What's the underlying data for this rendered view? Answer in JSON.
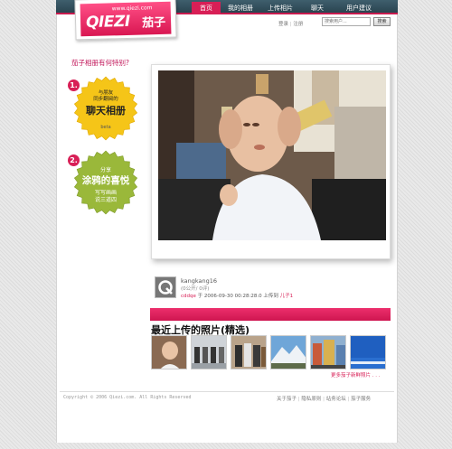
{
  "nav": {
    "items": [
      {
        "label": "首页",
        "active": true
      },
      {
        "label": "我的相册",
        "active": false
      },
      {
        "label": "上传相片",
        "active": false
      },
      {
        "label": "聊天",
        "active": false
      },
      {
        "label": "用户建议",
        "active": false
      }
    ]
  },
  "logo": {
    "url": "www.qiezi.com",
    "main": "QIEZI",
    "cn": "茄子"
  },
  "header_links": {
    "login": "登录",
    "separator": "|",
    "register": "注册"
  },
  "search": {
    "placeholder": "搜索用户...",
    "button": "搜索"
  },
  "sidebar": {
    "question": "茄子相册有何特别?",
    "feature1": {
      "num": "1.",
      "line1": "与朋友",
      "line2": "同步翻阅的",
      "title": "聊天相册",
      "tag": "beta",
      "color": "#f5c518"
    },
    "feature2": {
      "num": "2.",
      "line1": "分享",
      "title": "涂鸦的喜悦",
      "line3": "写写画画",
      "line4": "说三道四",
      "color": "#9ab83a"
    }
  },
  "photo_info": {
    "username": "kangkang16",
    "stats": "(0公开/ 0评)",
    "uploader": "cddqe",
    "action1": "于",
    "time": "2006-09-30 00:28:28.0",
    "action2": "上传到",
    "album": "儿子1"
  },
  "recent": {
    "title": "最近上传的照片(精选)",
    "more": "更多茄子新鲜照片 . . .",
    "thumb_count": 6
  },
  "footer": {
    "copyright": "Copyright © 2006 Qiezi.com. All Rights Reserved",
    "links": [
      "关于茄子",
      "隐私原则",
      "站务论坛",
      "茄子服务"
    ],
    "separator": "|"
  },
  "colors": {
    "nav_bg": "#2f4c58",
    "accent": "#d81f56",
    "badge_yellow": "#f5c518",
    "badge_green": "#9ab83a"
  }
}
